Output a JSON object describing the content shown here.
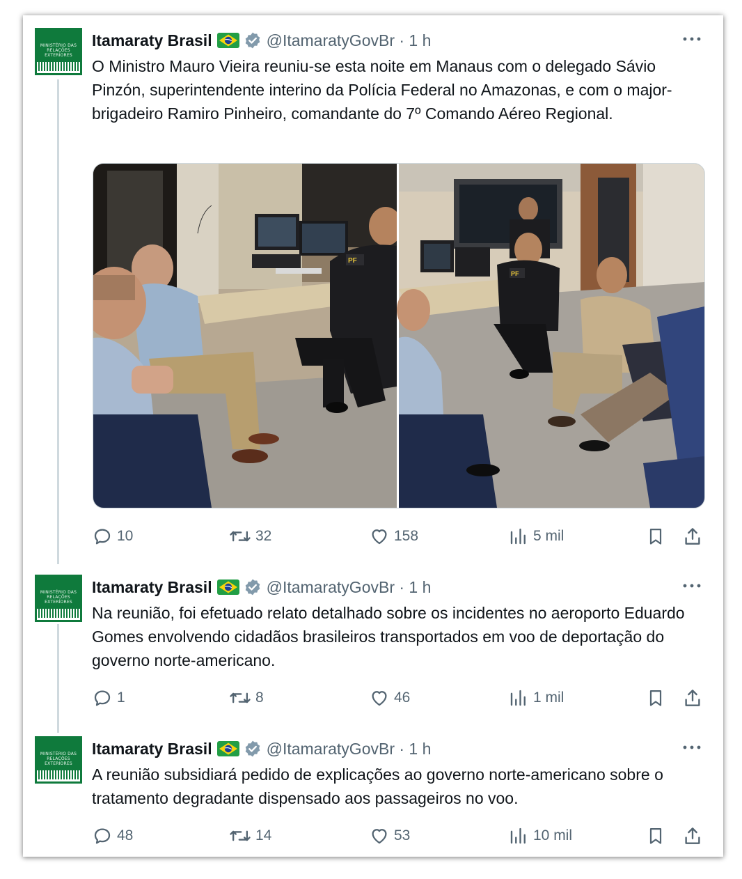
{
  "colors": {
    "verified": "#829aab",
    "text": "#0f1419",
    "muted": "#536471",
    "avatar_green": "#0f7a3c"
  },
  "avatar": {
    "lines": [
      "MINISTÉRIO DAS",
      "RELAÇÕES EXTERIORES"
    ]
  },
  "tweets": [
    {
      "name": "Itamaraty Brasil",
      "handle": "@ItamaratyGovBr · 1 h",
      "text": "O Ministro Mauro Vieira reuniu-se esta noite em Manaus com o delegado Sávio Pinzón, superintendente interino da Polícia Federal no Amazonas, e com o major-brigadeiro Ramiro Pinheiro, comandante do 7º Comando Aéreo Regional.",
      "media_badges": [
        "PF",
        "PF"
      ],
      "replies": "10",
      "retweets": "32",
      "likes": "158",
      "views": "5 mil"
    },
    {
      "name": "Itamaraty Brasil",
      "handle": "@ItamaratyGovBr · 1 h",
      "text": "Na reunião, foi efetuado relato detalhado sobre os incidentes no aeroporto Eduardo Gomes envolvendo cidadãos brasileiros transportados em voo de deportação do governo norte-americano.",
      "replies": "1",
      "retweets": "8",
      "likes": "46",
      "views": "1 mil"
    },
    {
      "name": "Itamaraty Brasil",
      "handle": "@ItamaratyGovBr · 1 h",
      "text": "A reunião subsidiará pedido de explicações ao governo norte-americano sobre o tratamento degradante dispensado aos passageiros no voo.",
      "replies": "48",
      "retweets": "14",
      "likes": "53",
      "views": "10 mil"
    }
  ]
}
